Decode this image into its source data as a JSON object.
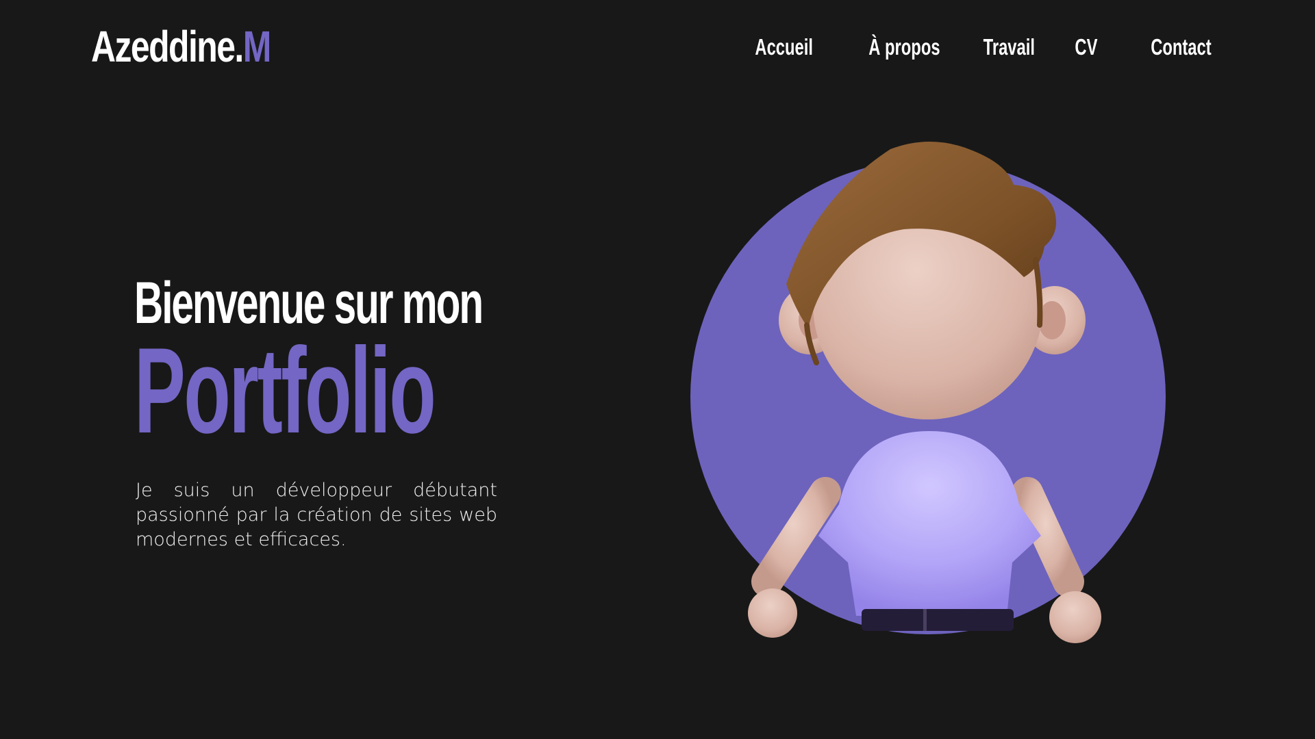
{
  "header": {
    "logo_main": "Azeddine.",
    "logo_accent": "M"
  },
  "nav": {
    "items": [
      {
        "label": "Accueil"
      },
      {
        "label": "À propos"
      },
      {
        "label": "Travail"
      },
      {
        "label": "CV"
      },
      {
        "label": "Contact"
      }
    ]
  },
  "hero": {
    "title_line1": "Bienvenue sur mon",
    "title_line2": "Portfolio",
    "description": "Je suis un développeur débutant passionné par la création de sites web modernes et efficaces."
  },
  "avatar": {
    "icon": "3d-avatar-illustration"
  },
  "colors": {
    "background": "#181818",
    "accent": "#7366c4",
    "text": "#ffffff"
  }
}
